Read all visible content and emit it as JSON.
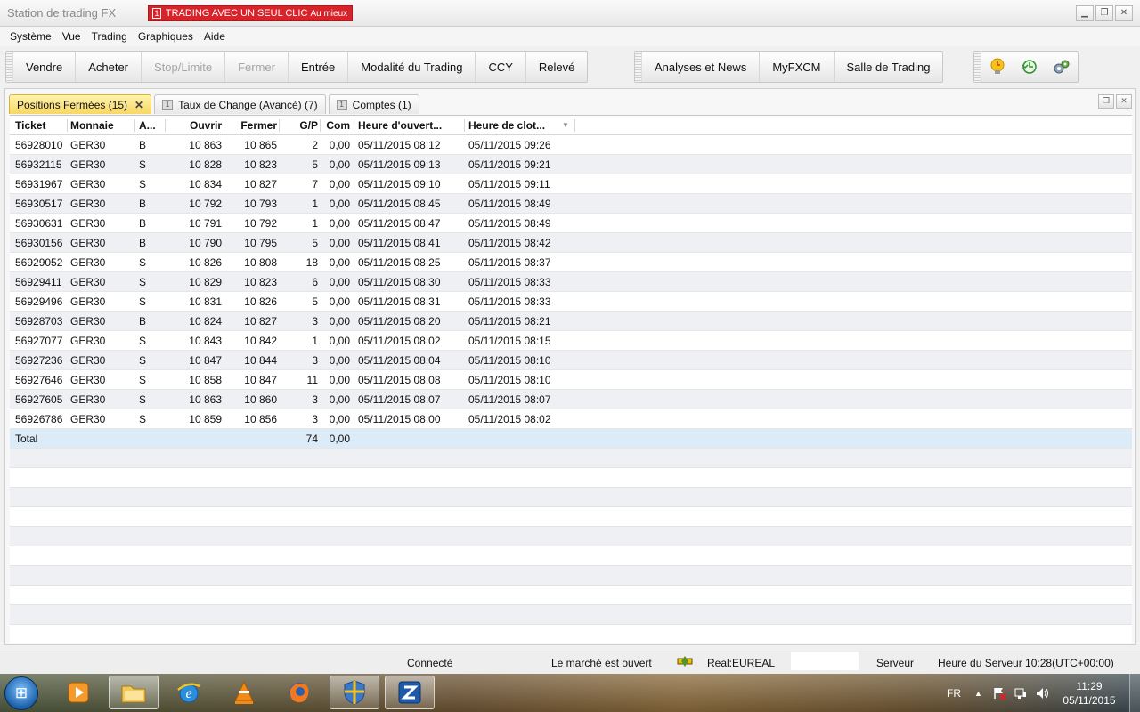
{
  "window": {
    "title": "Station de trading FX",
    "oneclick_num": "1",
    "oneclick_label": "TRADING AVEC UN SEUL CLIC",
    "oneclick_suffix": "Au mieux"
  },
  "menu": [
    "Système",
    "Vue",
    "Trading",
    "Graphiques",
    "Aide"
  ],
  "toolbar": {
    "group1": [
      {
        "label": "Vendre",
        "disabled": false
      },
      {
        "label": "Acheter",
        "disabled": false
      },
      {
        "label": "Stop/Limite",
        "disabled": true
      },
      {
        "label": "Fermer",
        "disabled": true
      },
      {
        "label": "Entrée",
        "disabled": false
      },
      {
        "label": "Modalité du Trading",
        "disabled": false
      },
      {
        "label": "CCY",
        "disabled": false
      },
      {
        "label": "Relevé",
        "disabled": false
      }
    ],
    "group2": [
      "Analyses et News",
      "MyFXCM",
      "Salle de Trading"
    ],
    "icons": [
      "lightbulb-icon",
      "clock-refresh-icon",
      "gears-icon"
    ]
  },
  "tabs": [
    {
      "label": "Positions Fermées (15)",
      "active": true
    },
    {
      "label": "Taux de Change (Avancé) (7)",
      "active": false
    },
    {
      "label": "Comptes (1)",
      "active": false
    }
  ],
  "table": {
    "headers": {
      "ticket": "Ticket",
      "ccy": "Monnaie",
      "side": "A...",
      "open": "Ouvrir",
      "close": "Fermer",
      "pl": "G/P",
      "com": "Com",
      "otime": "Heure d'ouvert...",
      "ctime": "Heure de clot..."
    },
    "rows": [
      {
        "ticket": "56928010",
        "ccy": "GER30",
        "side": "B",
        "open": "10 863",
        "close": "10 865",
        "pl": "2",
        "com": "0,00",
        "otime": "05/11/2015 08:12",
        "ctime": "05/11/2015 09:26"
      },
      {
        "ticket": "56932115",
        "ccy": "GER30",
        "side": "S",
        "open": "10 828",
        "close": "10 823",
        "pl": "5",
        "com": "0,00",
        "otime": "05/11/2015 09:13",
        "ctime": "05/11/2015 09:21"
      },
      {
        "ticket": "56931967",
        "ccy": "GER30",
        "side": "S",
        "open": "10 834",
        "close": "10 827",
        "pl": "7",
        "com": "0,00",
        "otime": "05/11/2015 09:10",
        "ctime": "05/11/2015 09:11"
      },
      {
        "ticket": "56930517",
        "ccy": "GER30",
        "side": "B",
        "open": "10 792",
        "close": "10 793",
        "pl": "1",
        "com": "0,00",
        "otime": "05/11/2015 08:45",
        "ctime": "05/11/2015 08:49"
      },
      {
        "ticket": "56930631",
        "ccy": "GER30",
        "side": "B",
        "open": "10 791",
        "close": "10 792",
        "pl": "1",
        "com": "0,00",
        "otime": "05/11/2015 08:47",
        "ctime": "05/11/2015 08:49"
      },
      {
        "ticket": "56930156",
        "ccy": "GER30",
        "side": "B",
        "open": "10 790",
        "close": "10 795",
        "pl": "5",
        "com": "0,00",
        "otime": "05/11/2015 08:41",
        "ctime": "05/11/2015 08:42"
      },
      {
        "ticket": "56929052",
        "ccy": "GER30",
        "side": "S",
        "open": "10 826",
        "close": "10 808",
        "pl": "18",
        "com": "0,00",
        "otime": "05/11/2015 08:25",
        "ctime": "05/11/2015 08:37"
      },
      {
        "ticket": "56929411",
        "ccy": "GER30",
        "side": "S",
        "open": "10 829",
        "close": "10 823",
        "pl": "6",
        "com": "0,00",
        "otime": "05/11/2015 08:30",
        "ctime": "05/11/2015 08:33"
      },
      {
        "ticket": "56929496",
        "ccy": "GER30",
        "side": "S",
        "open": "10 831",
        "close": "10 826",
        "pl": "5",
        "com": "0,00",
        "otime": "05/11/2015 08:31",
        "ctime": "05/11/2015 08:33"
      },
      {
        "ticket": "56928703",
        "ccy": "GER30",
        "side": "B",
        "open": "10 824",
        "close": "10 827",
        "pl": "3",
        "com": "0,00",
        "otime": "05/11/2015 08:20",
        "ctime": "05/11/2015 08:21"
      },
      {
        "ticket": "56927077",
        "ccy": "GER30",
        "side": "S",
        "open": "10 843",
        "close": "10 842",
        "pl": "1",
        "com": "0,00",
        "otime": "05/11/2015 08:02",
        "ctime": "05/11/2015 08:15"
      },
      {
        "ticket": "56927236",
        "ccy": "GER30",
        "side": "S",
        "open": "10 847",
        "close": "10 844",
        "pl": "3",
        "com": "0,00",
        "otime": "05/11/2015 08:04",
        "ctime": "05/11/2015 08:10"
      },
      {
        "ticket": "56927646",
        "ccy": "GER30",
        "side": "S",
        "open": "10 858",
        "close": "10 847",
        "pl": "11",
        "com": "0,00",
        "otime": "05/11/2015 08:08",
        "ctime": "05/11/2015 08:10"
      },
      {
        "ticket": "56927605",
        "ccy": "GER30",
        "side": "S",
        "open": "10 863",
        "close": "10 860",
        "pl": "3",
        "com": "0,00",
        "otime": "05/11/2015 08:07",
        "ctime": "05/11/2015 08:07"
      },
      {
        "ticket": "56926786",
        "ccy": "GER30",
        "side": "S",
        "open": "10 859",
        "close": "10 856",
        "pl": "3",
        "com": "0,00",
        "otime": "05/11/2015 08:00",
        "ctime": "05/11/2015 08:02"
      }
    ],
    "total": {
      "label": "Total",
      "pl": "74",
      "com": "0,00"
    }
  },
  "status": {
    "connection": "Connecté",
    "market": "Le marché est ouvert",
    "account": "Real:EUREAL",
    "server": "Serveur",
    "server_time": "Heure du Serveur 10:28(UTC+00:00)"
  },
  "taskbar": {
    "apps": [
      "media-player-icon",
      "file-explorer-icon",
      "internet-explorer-icon",
      "vlc-icon",
      "firefox-icon",
      "security-shield-icon",
      "trading-app-icon"
    ],
    "lang": "FR",
    "time": "11:29",
    "date": "05/11/2015"
  }
}
